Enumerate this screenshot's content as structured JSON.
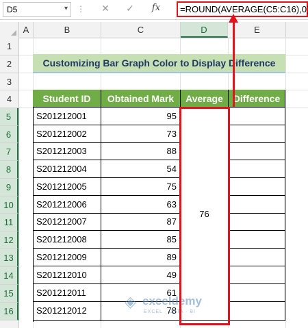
{
  "formula_bar": {
    "name_box": "D5",
    "cancel_icon": "✕",
    "enter_icon": "✓",
    "fx_label": "fx",
    "formula": "=ROUND(AVERAGE(C5:C16),0)"
  },
  "columns": [
    "A",
    "B",
    "C",
    "D",
    "E"
  ],
  "selected_column": "D",
  "rows": [
    "1",
    "2",
    "3",
    "4",
    "5",
    "6",
    "7",
    "8",
    "9",
    "10",
    "11",
    "12",
    "13",
    "14",
    "15",
    "16"
  ],
  "title": "Customizing Bar Graph Color to Display Difference",
  "table": {
    "headers": [
      "Student ID",
      "Obtained Mark",
      "Average",
      "Difference"
    ],
    "records": [
      {
        "id": "S201212001",
        "mark": "95"
      },
      {
        "id": "S201212002",
        "mark": "73"
      },
      {
        "id": "S201212003",
        "mark": "88"
      },
      {
        "id": "S201212004",
        "mark": "54"
      },
      {
        "id": "S201212005",
        "mark": "75"
      },
      {
        "id": "S201212006",
        "mark": "63"
      },
      {
        "id": "S201212007",
        "mark": "87"
      },
      {
        "id": "S201212008",
        "mark": "85"
      },
      {
        "id": "S201212009",
        "mark": "89"
      },
      {
        "id": "S201212010",
        "mark": "49"
      },
      {
        "id": "S201212011",
        "mark": "61"
      },
      {
        "id": "S201212012",
        "mark": "78"
      }
    ],
    "average": "76"
  },
  "watermark": {
    "name": "exceldemy",
    "tagline": "EXCEL · DATA · BI"
  },
  "colors": {
    "header_green": "#70ad47",
    "title_fill": "#c6e0b4",
    "highlight_red": "#e3131d"
  }
}
